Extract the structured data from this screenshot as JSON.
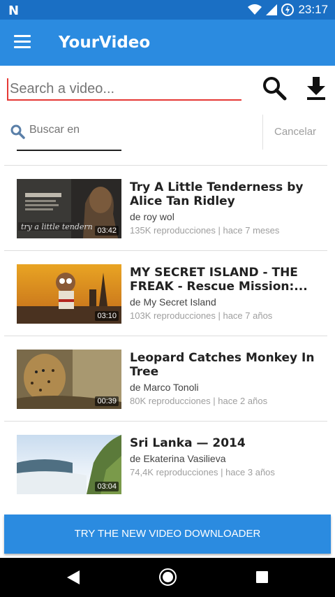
{
  "status_bar": {
    "time": "23:17",
    "notification_icon": "N"
  },
  "app_bar": {
    "title": "YourVideo"
  },
  "search": {
    "placeholder": "Search a video..."
  },
  "filter": {
    "label": "Buscar en",
    "cancel_label": "Cancelar"
  },
  "videos": [
    {
      "title": "Try A Little Tenderness by Alice Tan Ridley",
      "author": "de roy wol",
      "meta": "135K reproducciones | hace 7 meses",
      "duration": "03:42"
    },
    {
      "title": "MY SECRET ISLAND - THE FREAK - Rescue Mission:...",
      "author": "de My Secret Island",
      "meta": "103K reproducciones | hace 7 años",
      "duration": "03:10"
    },
    {
      "title": "Leopard Catches Monkey In Tree",
      "author": "de Marco Tonoli",
      "meta": "80K reproducciones | hace 2 años",
      "duration": "00:39"
    },
    {
      "title": "Sri Lanka — 2014",
      "author": "de Ekaterina Vasilieva",
      "meta": "74,4K reproducciones | hace 3 años",
      "duration": "03:04"
    }
  ],
  "cta": {
    "label": "TRY THE NEW VIDEO DOWNLOADER"
  },
  "colors": {
    "app_bar": "#2b8be0",
    "status_bar": "#1a6fc4",
    "accent_underline": "#e53935"
  },
  "icons": {
    "menu": "hamburger-icon",
    "search": "magnifier-icon",
    "download": "download-icon",
    "filter": "magnifier-icon"
  }
}
